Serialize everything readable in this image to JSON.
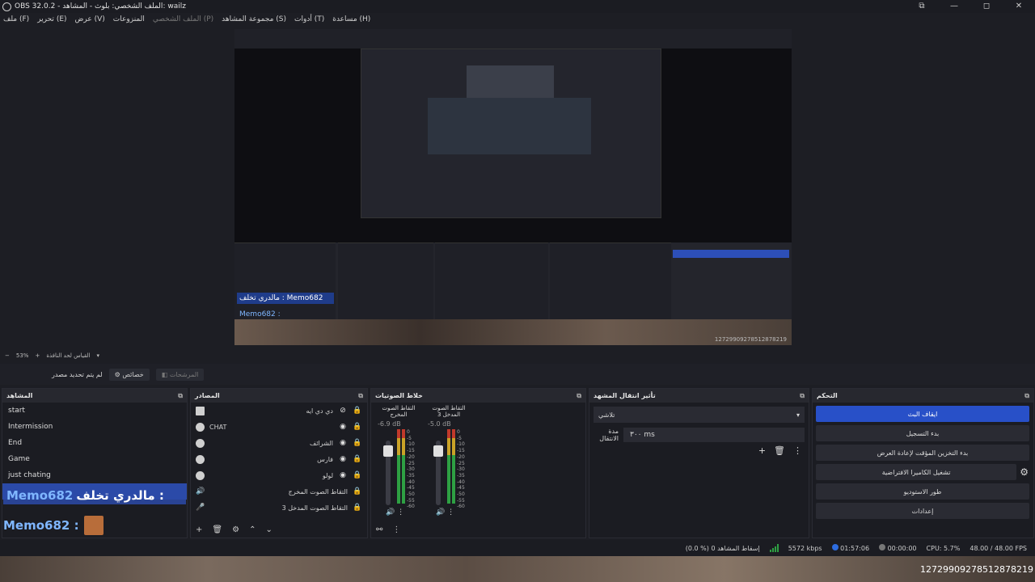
{
  "window": {
    "title": "OBS 32.0.2 - الملف الشخصي: بلوث - المشاهد: wailz",
    "controls": [
      "⧉",
      "—",
      "◻",
      "✕"
    ]
  },
  "menu": [
    "ملف (F)",
    "تحرير (E)",
    "عرض (V)",
    "المنزوعات",
    "الملف الشخصي (P)",
    "مجموعة المشاهد (S)",
    "أدوات (T)",
    "مساعدة (H)"
  ],
  "preview": {
    "memo_a": "مالدري تخلف : Memo682",
    "memo_b": "Memo682 :",
    "id_text": "12729909278512878219"
  },
  "zoombar": {
    "zoom": "53%",
    "label": "القياس لحد النافذة"
  },
  "srcbar": {
    "no_source": "لم يتم تحديد مصدر",
    "properties": "خصائص",
    "filters": "المرشحات"
  },
  "scenes": {
    "title": "المشاهد",
    "items": [
      "start",
      "Intermission",
      "End",
      "Game",
      "just chating"
    ]
  },
  "sources": {
    "title": "المصادر",
    "items": [
      {
        "name": "دي دي ايه",
        "ltr": false
      },
      {
        "name": "CHAT",
        "ltr": true
      },
      {
        "name": "الشرائف",
        "ltr": false
      },
      {
        "name": "فارس",
        "ltr": false
      },
      {
        "name": "لولو",
        "ltr": false
      },
      {
        "name": "التقاط الصوت المخرج",
        "ltr": false
      },
      {
        "name": "التقاط الصوت المدخل 3",
        "ltr": false
      }
    ]
  },
  "mixer": {
    "title": "خلاط الصوتيات",
    "channels": [
      {
        "name": "التقاط الصوت المخرج",
        "db": "-6.9 dB"
      },
      {
        "name": "التقاط الصوت المدخل 3",
        "db": "-5.0 dB"
      }
    ],
    "scale": [
      "0",
      "-5",
      "-10",
      "-15",
      "-20",
      "-25",
      "-30",
      "-35",
      "-40",
      "-45",
      "-50",
      "-55",
      "-60"
    ]
  },
  "transition": {
    "title": "تأثير انتقال المشهد",
    "type": "تلاشي",
    "duration_label": "مدة الانتقال",
    "duration_value": "٣٠٠ ms"
  },
  "controls": {
    "title": "التحكم",
    "buttons": [
      "ايقاف البث",
      "بدء التسجيل",
      "بدء التخزين المؤقت لإعادة العرض",
      "تشغيل الكاميرا الافتراضية",
      "طور الاستوديو",
      "إعدادات"
    ]
  },
  "chat": {
    "row1_msg": "مالدري تخلف :",
    "row1_user": "Memo682",
    "row2_user": "Memo682 :"
  },
  "status": {
    "dropped": "(0.0 %) إسقاط المشاهد 0",
    "bitrate": "5572 kbps",
    "rec_time": "01:57:06",
    "live_time": "00:00:00",
    "cpu": "CPU: 5.7%",
    "fps": "48.00 / 48.00 FPS"
  },
  "bottom_id": "12729909278512878219"
}
